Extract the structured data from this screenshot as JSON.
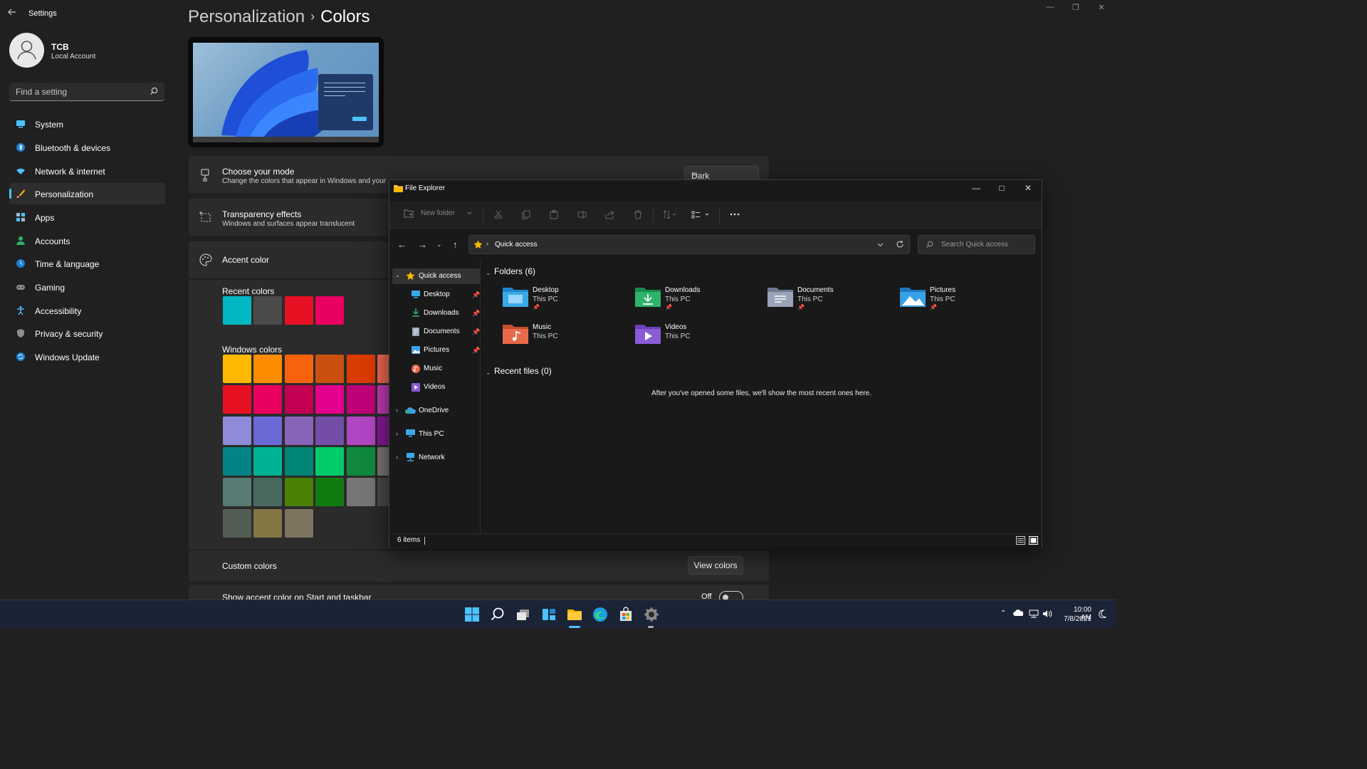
{
  "settings": {
    "app_title": "Settings",
    "user": {
      "name": "TCB",
      "account_type": "Local Account"
    },
    "search_placeholder": "Find a setting",
    "nav": [
      {
        "label": "System",
        "icon": "monitor-icon"
      },
      {
        "label": "Bluetooth & devices",
        "icon": "bluetooth-icon"
      },
      {
        "label": "Network & internet",
        "icon": "wifi-icon"
      },
      {
        "label": "Personalization",
        "icon": "brush-icon",
        "active": true
      },
      {
        "label": "Apps",
        "icon": "apps-icon"
      },
      {
        "label": "Accounts",
        "icon": "person-icon"
      },
      {
        "label": "Time & language",
        "icon": "globe-clock-icon"
      },
      {
        "label": "Gaming",
        "icon": "gamepad-icon"
      },
      {
        "label": "Accessibility",
        "icon": "accessibility-icon"
      },
      {
        "label": "Privacy & security",
        "icon": "shield-icon"
      },
      {
        "label": "Windows Update",
        "icon": "update-icon"
      }
    ],
    "breadcrumb": {
      "parent": "Personalization",
      "separator": "›",
      "current": "Colors"
    },
    "mode": {
      "title": "Choose your mode",
      "subtitle": "Change the colors that appear in Windows and your",
      "value": "Dark"
    },
    "transparency": {
      "title": "Transparency effects",
      "subtitle": "Windows and surfaces appear translucent"
    },
    "accent": {
      "title": "Accent color"
    },
    "recent_colors": {
      "label": "Recent colors",
      "colors": [
        "#00b7c3",
        "#4a4a4a",
        "#e81123",
        "#ea005e"
      ]
    },
    "windows_colors": {
      "label": "Windows colors",
      "rows": [
        [
          "#ffb900",
          "#ff8c00",
          "#f7630c",
          "#ca5010",
          "#da3b01",
          "#ef6950"
        ],
        [
          "#e81123",
          "#ea005e",
          "#c30052",
          "#e3008c",
          "#bf0077",
          "#c239b3"
        ],
        [
          "#8e8cd8",
          "#6b69d6",
          "#8764b8",
          "#744da9",
          "#b146c2",
          "#881798"
        ],
        [
          "#038387",
          "#00b294",
          "#018574",
          "#00cc6a",
          "#10893e",
          "#7a7574"
        ],
        [
          "#567c73",
          "#486860",
          "#498205",
          "#107c10",
          "#767676",
          "#4c4a48"
        ],
        [
          "#525e54",
          "#847545",
          "#7e735f"
        ]
      ]
    },
    "custom_colors": {
      "label": "Custom colors",
      "button": "View colors"
    },
    "accent_start": {
      "label": "Show accent color on Start and taskbar",
      "state": "Off"
    }
  },
  "explorer": {
    "title": "File Explorer",
    "toolbar": {
      "new_folder": "New folder"
    },
    "address": {
      "location": "Quick access"
    },
    "search_placeholder": "Search Quick access",
    "tree": {
      "quick_access": "Quick access",
      "pinned": [
        "Desktop",
        "Downloads",
        "Documents",
        "Pictures"
      ],
      "unpinned": [
        "Music",
        "Videos"
      ],
      "roots": [
        "OneDrive",
        "This PC",
        "Network"
      ]
    },
    "folders_header": "Folders (6)",
    "folders": [
      {
        "name": "Desktop",
        "location": "This PC",
        "pinned": true,
        "color": "#39a9e8"
      },
      {
        "name": "Downloads",
        "location": "This PC",
        "pinned": true,
        "color": "#2db36b"
      },
      {
        "name": "Documents",
        "location": "This PC",
        "pinned": true,
        "color": "#9aa4b8"
      },
      {
        "name": "Pictures",
        "location": "This PC",
        "pinned": true,
        "color": "#3aa0e8"
      },
      {
        "name": "Music",
        "location": "This PC",
        "pinned": false,
        "color": "#e86a4a"
      },
      {
        "name": "Videos",
        "location": "This PC",
        "pinned": false,
        "color": "#8a5cd6"
      }
    ],
    "recent_header": "Recent files (0)",
    "recent_empty": "After you've opened some files, we'll show the most recent ones here.",
    "status": "6 items"
  },
  "taskbar": {
    "apps": [
      "start-icon",
      "search-icon",
      "task-view-icon",
      "widgets-icon",
      "file-explorer-icon",
      "edge-icon",
      "store-icon",
      "settings-icon"
    ],
    "time": "10:00 AM",
    "date": "7/8/2021"
  },
  "colors": {
    "accent": "#4cc2ff",
    "taskbar": "#1b2336"
  }
}
